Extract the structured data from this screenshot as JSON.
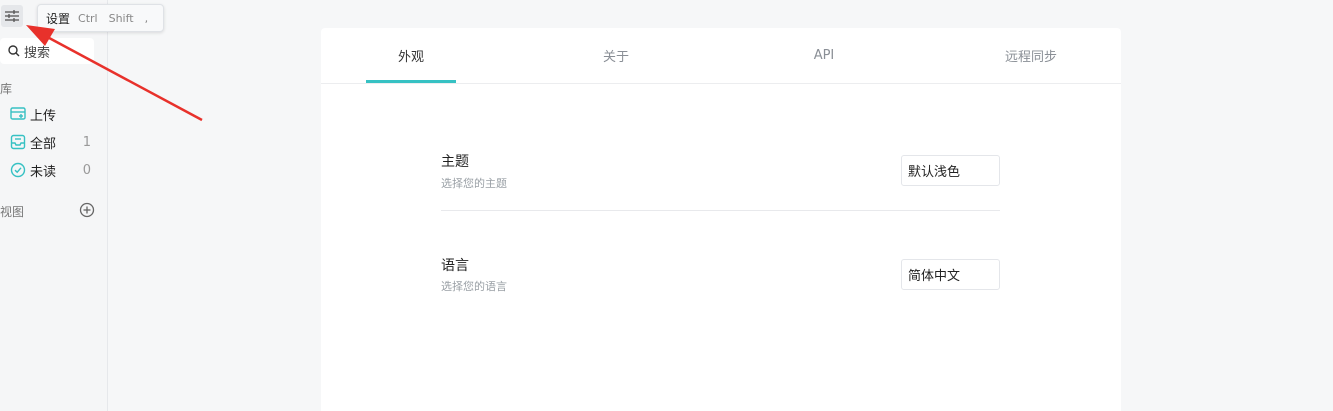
{
  "tooltip": {
    "label": "设置",
    "keys": [
      "Ctrl",
      "Shift",
      ","
    ]
  },
  "sidebar": {
    "search_label": "搜索",
    "library_label": "库",
    "items": [
      {
        "label": "上传",
        "count": "",
        "icon": "upload-icon"
      },
      {
        "label": "全部",
        "count": "1",
        "icon": "inbox-icon"
      },
      {
        "label": "未读",
        "count": "0",
        "icon": "check-circle-icon"
      }
    ],
    "views_label": "视图"
  },
  "tabs": [
    {
      "label": "外观",
      "active": true
    },
    {
      "label": "关于",
      "active": false
    },
    {
      "label": "API",
      "active": false
    },
    {
      "label": "远程同步",
      "active": false
    }
  ],
  "settings": {
    "theme": {
      "title": "主题",
      "description": "选择您的主题",
      "value": "默认浅色"
    },
    "language": {
      "title": "语言",
      "description": "选择您的语言",
      "value": "简体中文"
    }
  },
  "colors": {
    "accent": "#36c1c3",
    "annotation_arrow": "#e8312b"
  }
}
